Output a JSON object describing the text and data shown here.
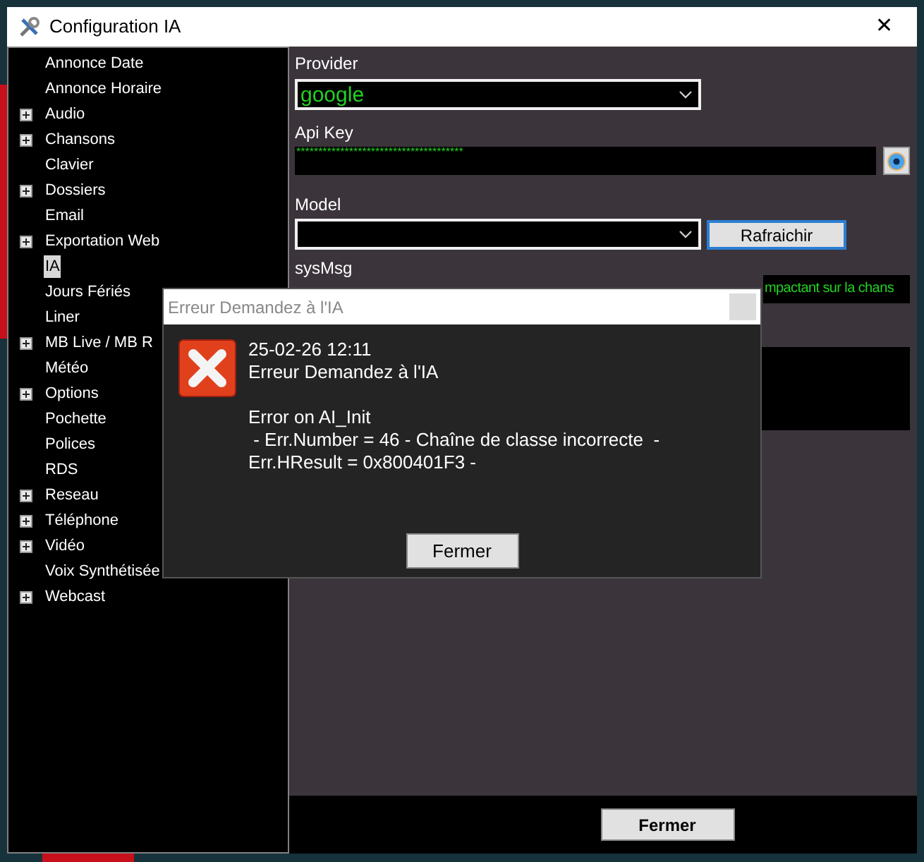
{
  "window": {
    "title": "Configuration IA",
    "close": "✕"
  },
  "tree": [
    {
      "label": "Annonce Date",
      "expandable": false,
      "selected": false
    },
    {
      "label": "Annonce Horaire",
      "expandable": false,
      "selected": false
    },
    {
      "label": "Audio",
      "expandable": true,
      "selected": false
    },
    {
      "label": "Chansons",
      "expandable": true,
      "selected": false
    },
    {
      "label": "Clavier",
      "expandable": false,
      "selected": false
    },
    {
      "label": "Dossiers",
      "expandable": true,
      "selected": false
    },
    {
      "label": "Email",
      "expandable": false,
      "selected": false
    },
    {
      "label": "Exportation Web",
      "expandable": true,
      "selected": false
    },
    {
      "label": "IA",
      "expandable": false,
      "selected": true
    },
    {
      "label": "Jours Fériés",
      "expandable": false,
      "selected": false
    },
    {
      "label": "Liner",
      "expandable": false,
      "selected": false
    },
    {
      "label": "MB Live / MB R",
      "expandable": true,
      "selected": false
    },
    {
      "label": "Météo",
      "expandable": false,
      "selected": false
    },
    {
      "label": "Options",
      "expandable": true,
      "selected": false
    },
    {
      "label": "Pochette",
      "expandable": false,
      "selected": false
    },
    {
      "label": "Polices",
      "expandable": false,
      "selected": false
    },
    {
      "label": "RDS",
      "expandable": false,
      "selected": false
    },
    {
      "label": "Reseau",
      "expandable": true,
      "selected": false
    },
    {
      "label": "Téléphone",
      "expandable": true,
      "selected": false
    },
    {
      "label": "Vidéo",
      "expandable": true,
      "selected": false
    },
    {
      "label": "Voix Synthétisée",
      "expandable": false,
      "selected": false
    },
    {
      "label": "Webcast",
      "expandable": true,
      "selected": false
    }
  ],
  "settings": {
    "provider": {
      "label": "Provider",
      "value": "google"
    },
    "api_key": {
      "label": "Api Key",
      "value": "**************************************"
    },
    "model": {
      "label": "Model",
      "refresh_button": "Rafraichir"
    },
    "sys_msg": {
      "label": "sysMsg",
      "value": "mpactant sur la chans"
    }
  },
  "close_button": "Fermer",
  "dialog": {
    "title": "Erreur Demandez à l'IA",
    "paragraphs": [
      [
        "25-02-26 12:11",
        "Erreur Demandez à l'IA"
      ],
      [
        "Error on AI_Init",
        " - Err.Number = 46 - Chaîne de classe incorrecte  -",
        "Err.HResult = 0x800401F3 -"
      ]
    ],
    "button": "Fermer"
  }
}
